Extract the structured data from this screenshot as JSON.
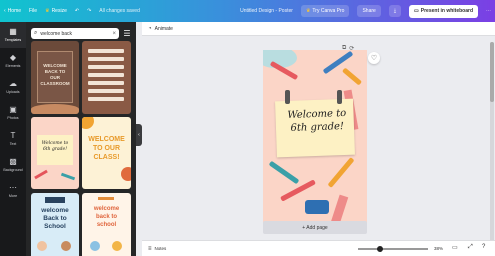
{
  "topbar": {
    "home": "Home",
    "file": "File",
    "resize": "Resize",
    "undo_icon": "undo-icon",
    "redo_icon": "redo-icon",
    "saved_status": "All changes saved",
    "doc_title": "Untitled Design - Poster",
    "try_pro": "Try Canva Pro",
    "share": "Share",
    "present": "Present in whiteboard",
    "accent": "#7b3fe4"
  },
  "rail": {
    "items": [
      {
        "label": "Templates",
        "icon": "templates-icon"
      },
      {
        "label": "Elements",
        "icon": "elements-icon"
      },
      {
        "label": "Uploads",
        "icon": "uploads-icon"
      },
      {
        "label": "Photos",
        "icon": "photos-icon"
      },
      {
        "label": "Text",
        "icon": "text-icon"
      },
      {
        "label": "Background",
        "icon": "background-icon"
      },
      {
        "label": "More",
        "icon": "more-icon"
      }
    ]
  },
  "panel": {
    "search_value": "welcome back"
  },
  "thumbs": {
    "t1": {
      "title": "WELCOME BACK TO OUR CLASSROOM"
    },
    "t3": {
      "title": "Welcome to 6th grade!"
    },
    "t4": {
      "title": "WELCOME TO OUR CLASS!"
    },
    "t5": {
      "title": "welcome Back to School"
    },
    "t6": {
      "title": "welcome back to school"
    }
  },
  "canvas": {
    "toolbar_label": "Animate",
    "note_text": "Welcome to 6th grade!",
    "add_page": "+ Add page"
  },
  "bottombar": {
    "notes": "Notes",
    "zoom": "38%",
    "zoom_fraction": 0.3
  }
}
